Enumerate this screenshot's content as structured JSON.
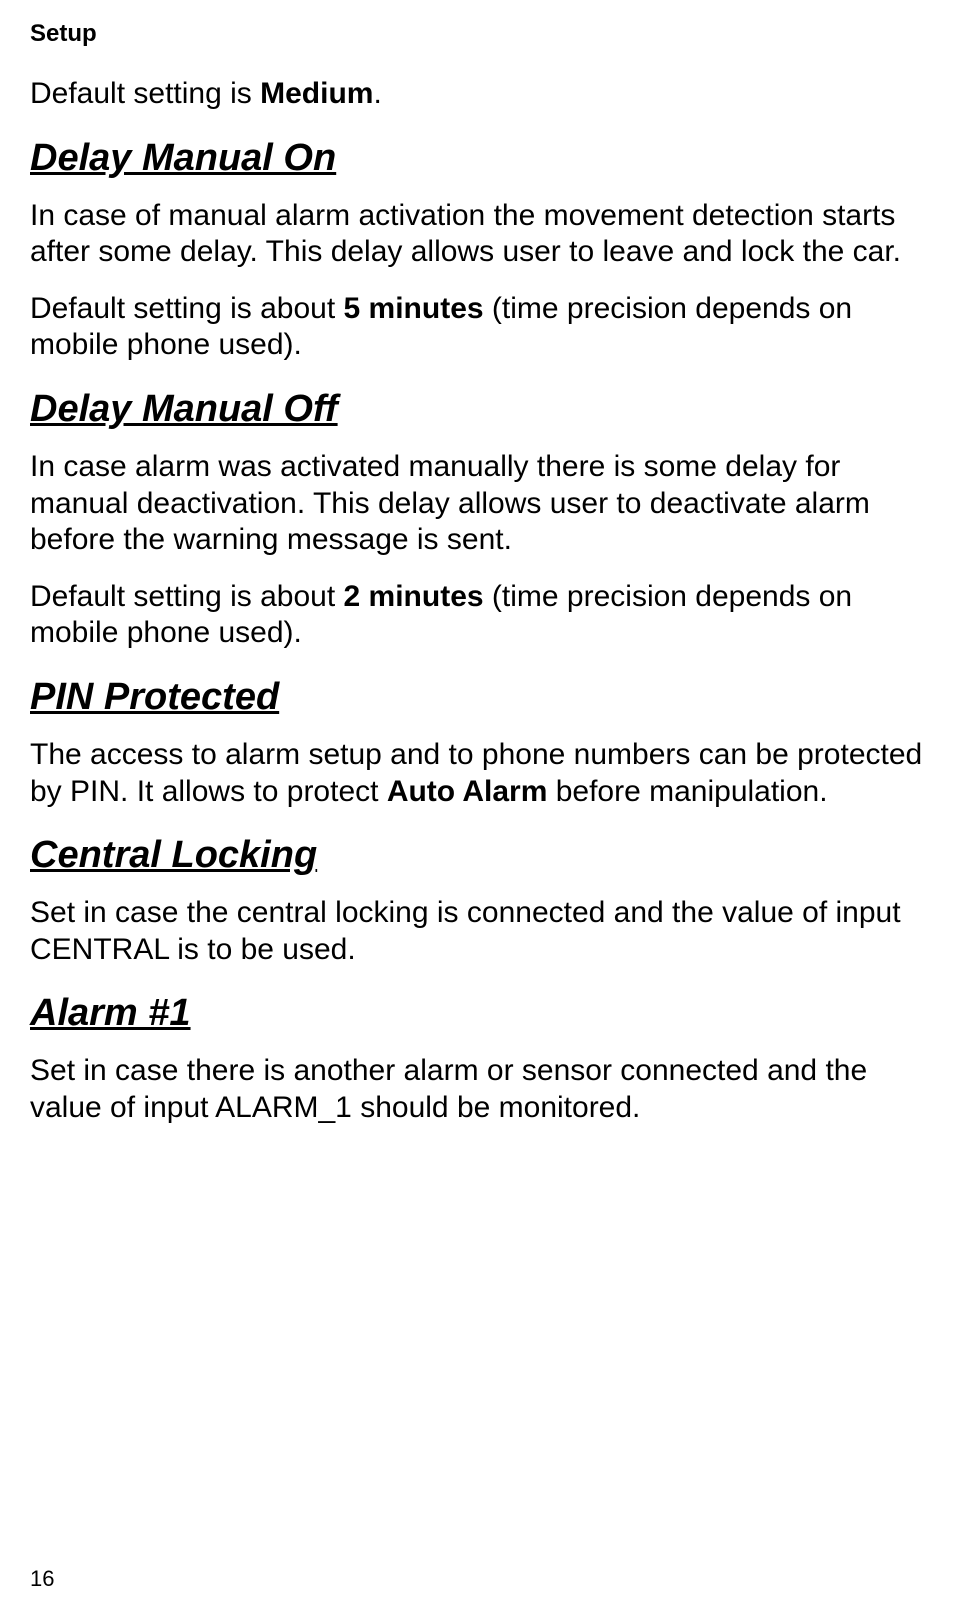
{
  "header": "Setup",
  "intro_prefix": "Default setting is ",
  "intro_bold": "Medium",
  "intro_suffix": ".",
  "sections": {
    "delay_on": {
      "heading": "Delay Manual On",
      "p1": "In case of manual alarm activation the movement detection starts after some delay. This delay allows user to leave and lock the car.",
      "p2_prefix": "Default setting is about ",
      "p2_bold": "5 minutes",
      "p2_suffix": " (time precision depends on mobile phone used)."
    },
    "delay_off": {
      "heading": "Delay Manual Off",
      "p1": "In case alarm was activated manually there is some delay for manual deactivation. This delay allows user to deactivate alarm before the warning message is sent.",
      "p2_prefix": "Default setting is about ",
      "p2_bold": "2 minutes",
      "p2_suffix": " (time precision depends on mobile phone used)."
    },
    "pin": {
      "heading": "PIN Protected",
      "p1_prefix": "The access to alarm setup and to phone numbers can be protected by PIN. It allows to protect ",
      "p1_bold": "Auto Alarm",
      "p1_suffix": " before manipulation."
    },
    "central": {
      "heading": "Central Locking",
      "p1": "Set in case the central locking is connected and the value of input CENTRAL is to be used."
    },
    "alarm1": {
      "heading": "Alarm #1",
      "p1": "Set in case there is another alarm or sensor connected and the value of input ALARM_1 should be monitored."
    }
  },
  "page_number": "16"
}
